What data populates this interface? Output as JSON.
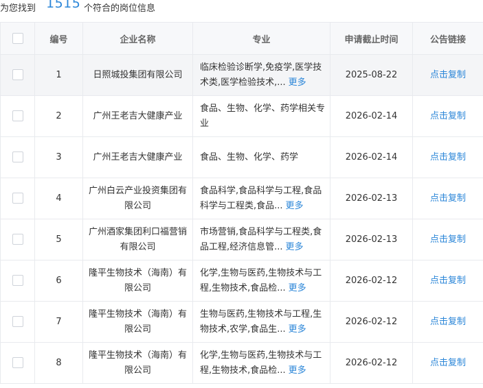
{
  "summary": {
    "prefix": "为您找到",
    "count": "1515",
    "suffix": "个符合的岗位信息"
  },
  "headers": {
    "index": "编号",
    "company": "企业名称",
    "major": "专业",
    "deadline": "申请截止时间",
    "link": "公告链接"
  },
  "more_label": "更多",
  "rows": [
    {
      "index": "1",
      "company": "日照城投集团有限公司",
      "major": "临床检验诊断学,免疫学,医学技术类,医学检验技术,...",
      "more": "更多",
      "deadline": "2025-08-22",
      "link": "点击复制"
    },
    {
      "index": "2",
      "company": "广州王老吉大健康产业",
      "major": "食品、生物、化学、药学相关专业",
      "more": "",
      "deadline": "2026-02-14",
      "link": "点击复制"
    },
    {
      "index": "3",
      "company": "广州王老吉大健康产业",
      "major": "食品、生物、化学、药学",
      "more": "",
      "deadline": "2026-02-14",
      "link": "点击复制"
    },
    {
      "index": "4",
      "company": "广州白云产业投资集团有限公司",
      "major": "食品科学,食品科学与工程,食品科学与工程类,食品...",
      "more": "更多",
      "deadline": "2026-02-13",
      "link": "点击复制"
    },
    {
      "index": "5",
      "company": "广州酒家集团利口福营销有限公司",
      "major": "市场营销,食品科学与工程类,食品工程,经济信息管...",
      "more": "更多",
      "deadline": "2026-02-13",
      "link": "点击复制"
    },
    {
      "index": "6",
      "company": "隆平生物技术（海南）有限公司",
      "major": "化学,生物与医药,生物技术与工程,生物技术,食品检...",
      "more": "更多",
      "deadline": "2026-02-12",
      "link": "点击复制"
    },
    {
      "index": "7",
      "company": "隆平生物技术（海南）有限公司",
      "major": "生物与医药,生物技术与工程,生物技术,农学,食品生...",
      "more": "更多",
      "deadline": "2026-02-12",
      "link": "点击复制"
    },
    {
      "index": "8",
      "company": "隆平生物技术（海南）有限公司",
      "major": "化学,生物与医药,生物技术与工程,生物技术,食品检...",
      "more": "更多",
      "deadline": "2026-02-12",
      "link": "点击复制"
    }
  ]
}
